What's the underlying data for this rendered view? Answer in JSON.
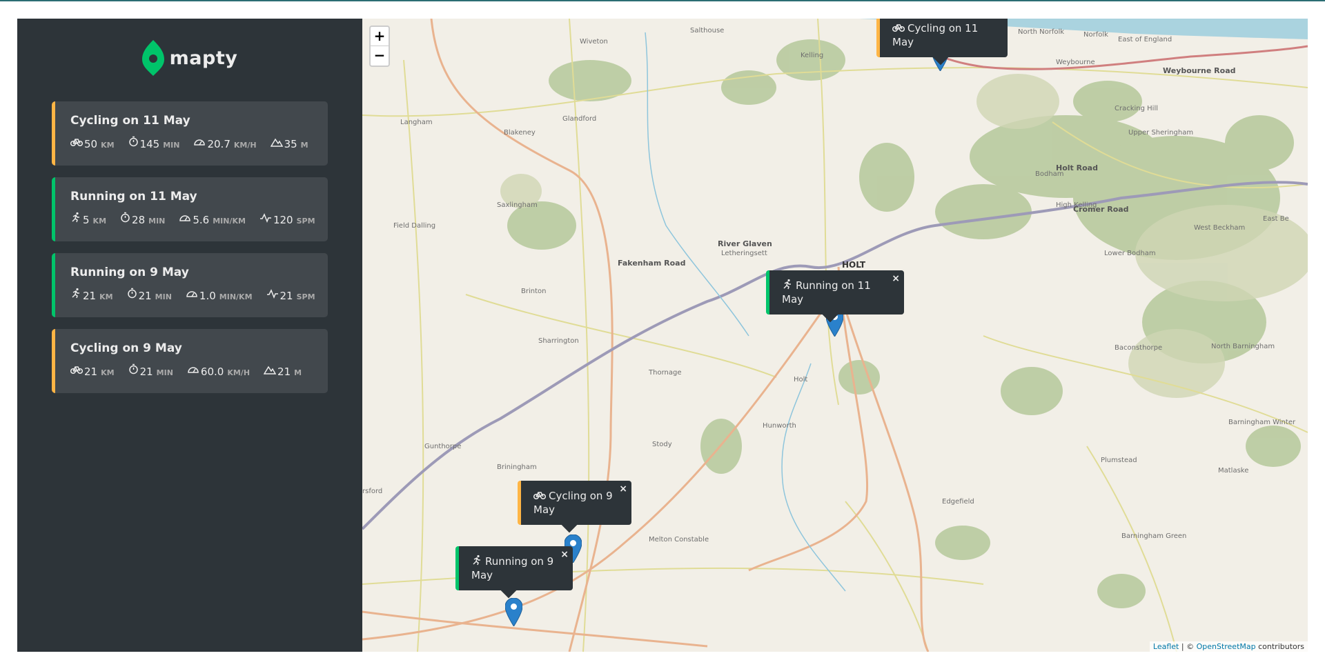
{
  "app": {
    "name": "mapty",
    "brand_color": "#00c46a",
    "cycling_color": "#ffb545",
    "running_color": "#00c46a"
  },
  "workouts": [
    {
      "type": "cycling",
      "title": "Cycling on 11 May",
      "details": [
        {
          "icon": "bicycle-icon",
          "value": "50",
          "unit": "KM"
        },
        {
          "icon": "stopwatch-icon",
          "value": "145",
          "unit": "MIN"
        },
        {
          "icon": "speedometer-icon",
          "value": "20.7",
          "unit": "KM/H"
        },
        {
          "icon": "mountain-icon",
          "value": "35",
          "unit": "M"
        }
      ]
    },
    {
      "type": "running",
      "title": "Running on 11 May",
      "details": [
        {
          "icon": "runner-icon",
          "value": "5",
          "unit": "KM"
        },
        {
          "icon": "stopwatch-icon",
          "value": "28",
          "unit": "MIN"
        },
        {
          "icon": "speedometer-icon",
          "value": "5.6",
          "unit": "MIN/KM"
        },
        {
          "icon": "cadence-icon",
          "value": "120",
          "unit": "SPM"
        }
      ]
    },
    {
      "type": "running",
      "title": "Running on 9 May",
      "details": [
        {
          "icon": "runner-icon",
          "value": "21",
          "unit": "KM"
        },
        {
          "icon": "stopwatch-icon",
          "value": "21",
          "unit": "MIN"
        },
        {
          "icon": "speedometer-icon",
          "value": "1.0",
          "unit": "MIN/KM"
        },
        {
          "icon": "cadence-icon",
          "value": "21",
          "unit": "SPM"
        }
      ]
    },
    {
      "type": "cycling",
      "title": "Cycling on 9 May",
      "details": [
        {
          "icon": "bicycle-icon",
          "value": "21",
          "unit": "KM"
        },
        {
          "icon": "stopwatch-icon",
          "value": "21",
          "unit": "MIN"
        },
        {
          "icon": "speedometer-icon",
          "value": "60.0",
          "unit": "KM/H"
        },
        {
          "icon": "mountain-icon",
          "value": "21",
          "unit": "M"
        }
      ]
    }
  ],
  "map": {
    "zoom_in": "+",
    "zoom_out": "−",
    "close_symbol": "×",
    "popups": [
      {
        "type": "cycling",
        "text": "Cycling on 11 May"
      },
      {
        "type": "running",
        "text": "Running on 11 May"
      },
      {
        "type": "cycling",
        "text": "Cycling on 9 May"
      },
      {
        "type": "running",
        "text": "Running on 9 May"
      }
    ],
    "place_labels": [
      "Wiveton",
      "Salthouse",
      "Kelling",
      "North Norfolk",
      "Norfolk",
      "East of England",
      "Weybourne",
      "Weybourne Road",
      "Langham",
      "Glandford",
      "Blakeney",
      "Cracking Hill",
      "Upper Sheringham",
      "Bodham",
      "Holt Road",
      "Saxlingham",
      "High Kelling",
      "Cromer Road",
      "West Beckham",
      "East Be",
      "Field Dalling",
      "River Glaven",
      "Letheringsett",
      "HOLT",
      "Lower Bodham",
      "Brinton",
      "Fakenham Road",
      "Sharrington",
      "Baconsthorpe",
      "North Barningham",
      "Thornage",
      "Holt",
      "Gunthorpe",
      "Stody",
      "Hunworth",
      "Barningham Winter",
      "Briningham",
      "Plumstead",
      "Matlaske",
      "Edgefield",
      "Melton Constable",
      "Barningham Green",
      "rsford"
    ],
    "attribution": {
      "leaflet": "Leaflet",
      "separator": " | © ",
      "osm": "OpenStreetMap",
      "suffix": " contributors"
    }
  }
}
